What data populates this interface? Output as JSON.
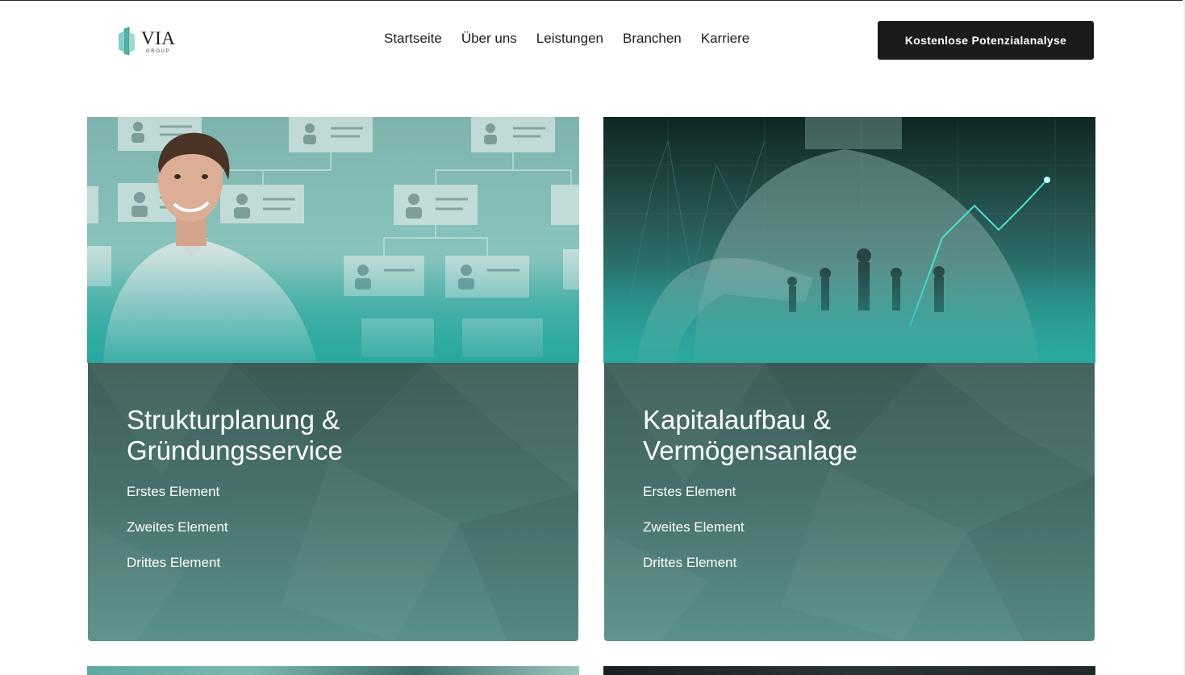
{
  "brand": {
    "name": "VIA",
    "sub": "GROUP",
    "accent": "#5fb8ad"
  },
  "nav": {
    "items": [
      {
        "label": "Startseite"
      },
      {
        "label": "Über uns"
      },
      {
        "label": "Leistungen"
      },
      {
        "label": "Branchen"
      },
      {
        "label": "Karriere"
      }
    ]
  },
  "cta": {
    "label": "Kostenlose Potenzialanalyse",
    "bg": "#1b1b1b"
  },
  "cards": [
    {
      "title_line1": "Strukturplanung &",
      "title_line2": "Gründungsservice",
      "items": [
        "Erstes Element",
        "Zweites Element",
        "Drittes Element"
      ]
    },
    {
      "title_line1": "Kapitalaufbau &",
      "title_line2": "Vermögensanlage",
      "items": [
        "Erstes Element",
        "Zweites Element",
        "Drittes Element"
      ]
    }
  ],
  "colors": {
    "teal": "#2aa89f",
    "card_dark": "#3f5f5c",
    "card_light": "#5a918b"
  }
}
